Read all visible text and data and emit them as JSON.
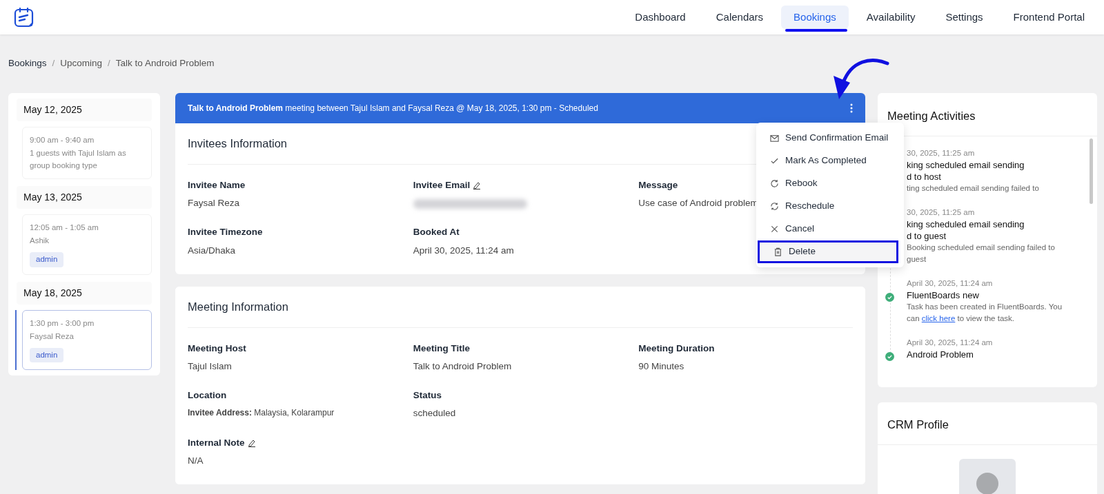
{
  "nav": {
    "items": [
      {
        "label": "Dashboard",
        "selected": false
      },
      {
        "label": "Calendars",
        "selected": false
      },
      {
        "label": "Bookings",
        "selected": true
      },
      {
        "label": "Availability",
        "selected": false
      },
      {
        "label": "Settings",
        "selected": false
      },
      {
        "label": "Frontend Portal",
        "selected": false
      }
    ]
  },
  "breadcrumb": {
    "items": [
      "Bookings",
      "Upcoming",
      "Talk to Android Problem"
    ],
    "separator": "/"
  },
  "sidebar": {
    "groups": [
      {
        "date": "May 12, 2025",
        "bookings": [
          {
            "time": "9:00 am - 9:40 am",
            "text": "1 guests with Tajul Islam as group booking type",
            "selected": false
          }
        ]
      },
      {
        "date": "May 13, 2025",
        "bookings": [
          {
            "time": "12:05 am - 1:05 am",
            "text": "Ashik",
            "tag": "admin",
            "selected": false
          }
        ]
      },
      {
        "date": "May 18, 2025",
        "bookings": [
          {
            "time": "1:30 pm - 3:00 pm",
            "text": "Faysal Reza",
            "tag": "admin",
            "selected": true
          }
        ]
      }
    ]
  },
  "banner": {
    "text": "**Talk to Android Problem** meeting between Tajul Islam and Faysal Reza @ May 18, 2025, 1:30 pm - Scheduled"
  },
  "invitees": {
    "title": "Invitees Information",
    "rows": [
      [
        {
          "label": "Invitee Name",
          "value": "Faysal Reza",
          "kind": "text"
        },
        {
          "label": "Invitee Email",
          "editable": true,
          "kind": "blurred"
        },
        {
          "label": "Message",
          "value": "Use case of Android problem",
          "kind": "text"
        }
      ],
      [
        {
          "label": "Invitee Timezone",
          "value": "Asia/Dhaka",
          "kind": "text"
        },
        {
          "label": "Booked At",
          "value": "April 30, 2025, 11:24 am",
          "kind": "text"
        }
      ]
    ]
  },
  "meeting": {
    "title": "Meeting Information",
    "rows": [
      [
        {
          "label": "Meeting Host",
          "value": "Tajul Islam",
          "kind": "text"
        },
        {
          "label": "Meeting Title",
          "value": "Talk to Android Problem",
          "kind": "text"
        },
        {
          "label": "Meeting Duration",
          "value": "90 Minutes",
          "kind": "text"
        }
      ],
      [
        {
          "label": "Location",
          "value": "**Invitee Address:** Malaysia, Kolarampur",
          "kind": "small"
        },
        {
          "label": "Status",
          "value": "scheduled",
          "kind": "text"
        }
      ],
      [
        {
          "label": "Internal Note",
          "value": "N/A",
          "editable": true,
          "kind": "text"
        }
      ]
    ]
  },
  "menu": {
    "items": [
      {
        "kind": "mail",
        "label": "Send Confirmation Email",
        "highlighted": false
      },
      {
        "kind": "check",
        "label": "Mark As Completed",
        "highlighted": false
      },
      {
        "kind": "rebook",
        "label": "Rebook",
        "highlighted": false
      },
      {
        "kind": "reschedule",
        "label": "Reschedule",
        "highlighted": false
      },
      {
        "kind": "cancel",
        "label": "Cancel",
        "highlighted": false
      },
      {
        "kind": "trash",
        "label": "Delete",
        "highlighted": true
      }
    ]
  },
  "activities": {
    "title": "Meeting Activities",
    "items": [
      {
        "date": "30, 2025, 11:25 am",
        "title_lines": [
          "king scheduled email sending",
          "d to host"
        ],
        "description": "ting scheduled email sending failed to"
      },
      {
        "date": "30, 2025, 11:25 am",
        "title_lines": [
          "king scheduled email sending",
          "d to guest"
        ],
        "description": "Booking scheduled email sending failed to guest"
      },
      {
        "date": "April 30, 2025, 11:24 am",
        "title_lines": [
          "FluentBoards new"
        ],
        "description": "Task has been created in FluentBoards. You can ",
        "link": "click here",
        "description_end": " to view the task.",
        "done": true
      },
      {
        "date": "April 30, 2025, 11:24 am",
        "title_lines": [
          "Android Problem"
        ],
        "done": true
      }
    ]
  },
  "crm": {
    "title": "CRM Profile"
  }
}
